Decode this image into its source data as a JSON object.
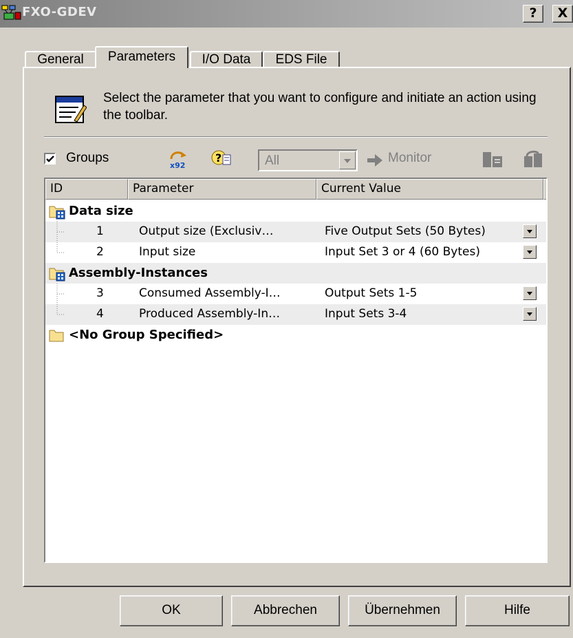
{
  "window": {
    "title": "FXO-GDEV",
    "help_btn": "?",
    "close_btn": "X"
  },
  "tabs": [
    "General",
    "Parameters",
    "I/O Data",
    "EDS File"
  ],
  "info": {
    "text": "Select the parameter that you want to configure and initiate an action using the toolbar."
  },
  "toolbar": {
    "groups_label": "Groups",
    "groups_checked": true,
    "filter_value": "All",
    "monitor_label": "Monitor"
  },
  "list": {
    "columns": [
      "ID",
      "Parameter",
      "Current Value"
    ],
    "groups": [
      {
        "name": "Data size",
        "rows": [
          {
            "id": "1",
            "param": "Output size  (Exclusiv…",
            "value": "Five Output Sets (50 Bytes)"
          },
          {
            "id": "2",
            "param": "Input size",
            "value": "Input Set 3 or 4 (60 Bytes)"
          }
        ]
      },
      {
        "name": "Assembly-Instances",
        "rows": [
          {
            "id": "3",
            "param": "Consumed Assembly-I…",
            "value": "Output Sets 1-5"
          },
          {
            "id": "4",
            "param": "Produced Assembly-In…",
            "value": "Input Sets 3-4"
          }
        ]
      },
      {
        "name": "<No Group Specified>",
        "rows": []
      }
    ]
  },
  "buttons": {
    "ok": "OK",
    "cancel": "Abbrechen",
    "apply": "Übernehmen",
    "help": "Hilfe"
  }
}
